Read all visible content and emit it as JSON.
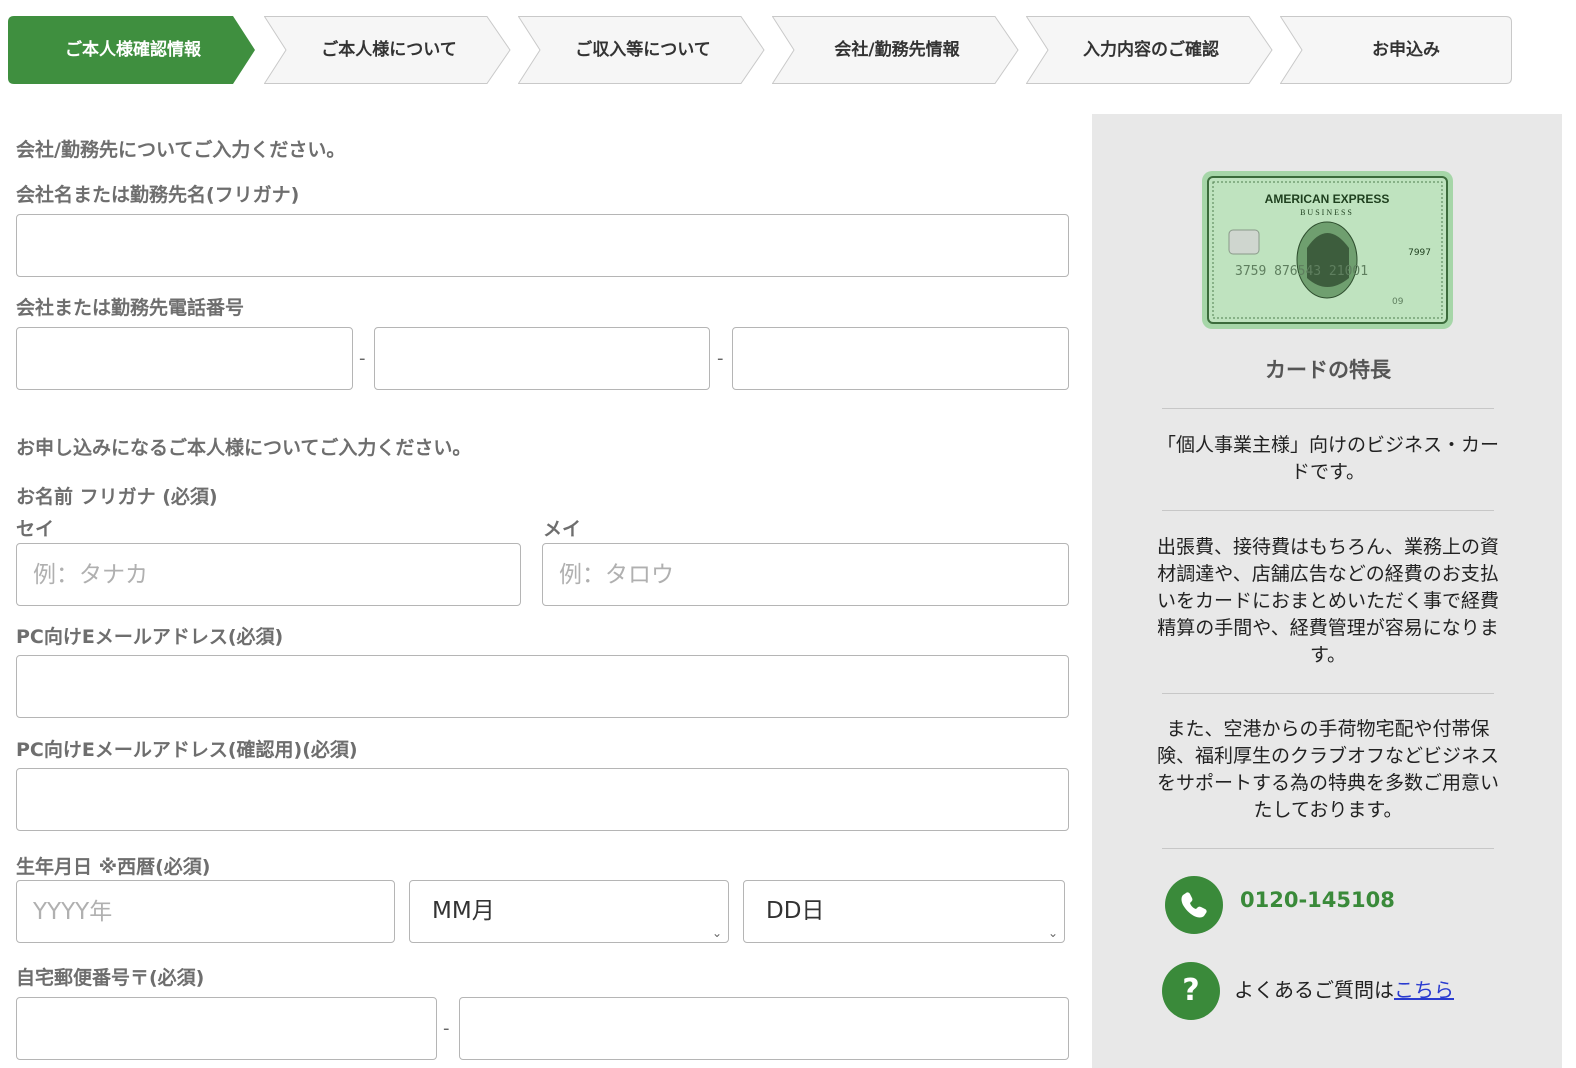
{
  "stepper": {
    "steps": [
      {
        "label": "ご本人様確認情報",
        "active": true
      },
      {
        "label": "ご本人様について",
        "active": false
      },
      {
        "label": "ご収入等について",
        "active": false
      },
      {
        "label": "会社/勤務先情報",
        "active": false
      },
      {
        "label": "入力内容のご確認",
        "active": false
      },
      {
        "label": "お申込み",
        "active": false
      }
    ]
  },
  "company": {
    "section_title": "会社/勤務先についてご入力ください。",
    "name_kana_label": "会社名または勤務先名(フリガナ)",
    "phone_label": "会社または勤務先電話番号",
    "dash": "-"
  },
  "personal": {
    "section_title": "お申し込みになるご本人様についてご入力ください。",
    "name_label": "お名前 フリガナ (必須)",
    "sei_label": "セイ",
    "mei_label": "メイ",
    "sei_placeholder": "例：タナカ",
    "mei_placeholder": "例：タロウ",
    "email_label": "PC向けEメールアドレス(必須)",
    "email_confirm_label": "PC向けEメールアドレス(確認用)(必須)",
    "birth_label": "生年月日 ※西暦(必須)",
    "year_placeholder": "YYYY年",
    "month_value": "MM月",
    "day_value": "DD日",
    "postal_label": "自宅郵便番号〒(必須)",
    "dash": "-"
  },
  "sidebar": {
    "card": {
      "brand": "AMERICAN EXPRESS",
      "sub": "BUSINESS",
      "number": "3759  876543  21001",
      "short": "7997",
      "valid": "09"
    },
    "heading": "カードの特長",
    "text1": "「個人事業主様」向けのビジネス・カードです。",
    "text2": "出張費、接待費はもちろん、業務上の資材調達や、店舗広告などの経費のお支払いをカードにおまとめいただく事で経費精算の手間や、経費管理が容易になります。",
    "text3": "また、空港からの手荷物宅配や付帯保険、福利厚生のクラブオフなどビジネスをサポートする為の特典を多数ご用意いたしております。",
    "phone": "0120-145108",
    "faq_prefix": "よくあるご質問は",
    "faq_link": "こちら"
  },
  "colors": {
    "accent": "#3a8a3a",
    "sidebar_bg": "#e8e8e8"
  }
}
